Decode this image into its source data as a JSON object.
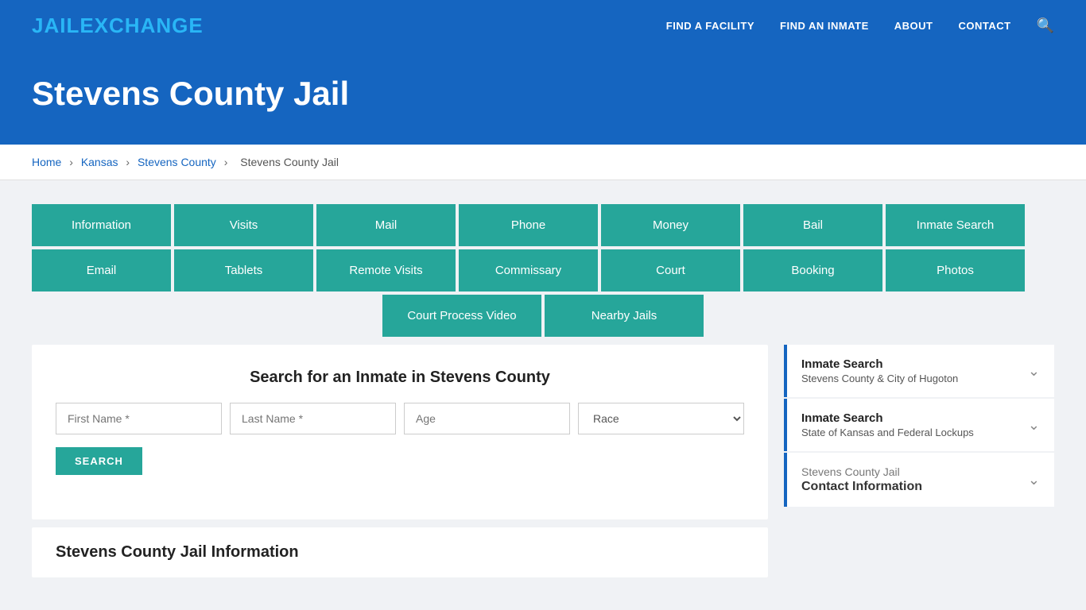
{
  "logo": {
    "part1": "JAIL",
    "part2": "EXCHANGE"
  },
  "nav": {
    "items": [
      {
        "label": "FIND A FACILITY",
        "id": "find-facility"
      },
      {
        "label": "FIND AN INMATE",
        "id": "find-inmate"
      },
      {
        "label": "ABOUT",
        "id": "about"
      },
      {
        "label": "CONTACT",
        "id": "contact"
      }
    ]
  },
  "hero": {
    "title": "Stevens County Jail"
  },
  "breadcrumb": {
    "items": [
      {
        "label": "Home",
        "id": "home"
      },
      {
        "label": "Kansas",
        "id": "kansas"
      },
      {
        "label": "Stevens County",
        "id": "stevens-county"
      },
      {
        "label": "Stevens County Jail",
        "id": "stevens-county-jail"
      }
    ]
  },
  "grid_buttons_row1": [
    "Information",
    "Visits",
    "Mail",
    "Phone",
    "Money",
    "Bail",
    "Inmate Search"
  ],
  "grid_buttons_row2": [
    "Email",
    "Tablets",
    "Remote Visits",
    "Commissary",
    "Court",
    "Booking",
    "Photos"
  ],
  "grid_buttons_row3": [
    "Court Process Video",
    "Nearby Jails"
  ],
  "search": {
    "title": "Search for an Inmate in Stevens County",
    "first_name_placeholder": "First Name *",
    "last_name_placeholder": "Last Name *",
    "age_placeholder": "Age",
    "race_placeholder": "Race",
    "button_label": "SEARCH"
  },
  "info_section": {
    "title": "Stevens County Jail Information"
  },
  "sidebar": {
    "items": [
      {
        "title": "Inmate Search",
        "subtitle": "Stevens County & City of Hugoton",
        "id": "inmate-search-1"
      },
      {
        "title": "Inmate Search",
        "subtitle": "State of Kansas and Federal Lockups",
        "id": "inmate-search-2"
      }
    ],
    "contact_item": {
      "top_text": "Stevens County Jail",
      "title": "Contact Information",
      "id": "contact-info"
    }
  }
}
